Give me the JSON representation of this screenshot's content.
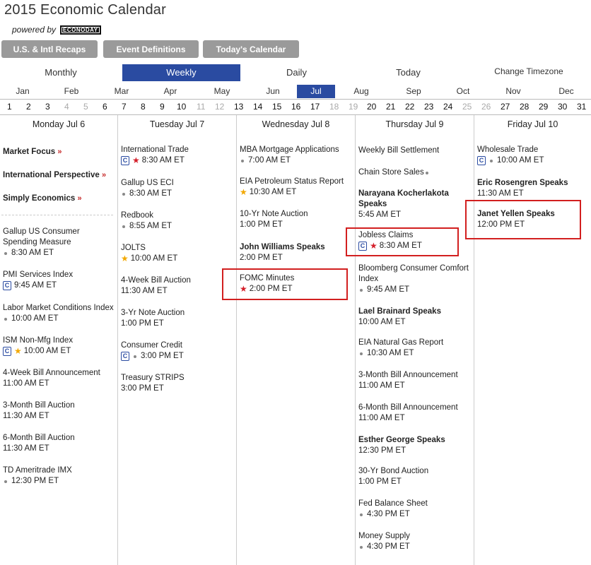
{
  "header": {
    "title": "2015 Economic Calendar",
    "powered_by": "powered by",
    "logo_text": "ECONODAY"
  },
  "top_buttons": [
    "U.S. & Intl Recaps",
    "Event Definitions",
    "Today's Calendar"
  ],
  "views": [
    "Monthly",
    "Weekly",
    "Daily",
    "Today",
    "Change Timezone"
  ],
  "active_view": "Weekly",
  "months": [
    "Jan",
    "Feb",
    "Mar",
    "Apr",
    "May",
    "Jun",
    "Jul",
    "Aug",
    "Sep",
    "Oct",
    "Nov",
    "Dec"
  ],
  "active_month": "Jul",
  "days": [
    "1",
    "2",
    "3",
    "4",
    "5",
    "6",
    "7",
    "8",
    "9",
    "10",
    "11",
    "12",
    "13",
    "14",
    "15",
    "16",
    "17",
    "18",
    "19",
    "20",
    "21",
    "22",
    "23",
    "24",
    "25",
    "26",
    "27",
    "28",
    "29",
    "30",
    "31"
  ],
  "gray_days": [
    "4",
    "5",
    "11",
    "12",
    "18",
    "19",
    "25",
    "26"
  ],
  "colors": {
    "accent": "#2a4ba1",
    "button_gray": "#9a9a9a",
    "star_red": "#d41f2a",
    "star_gold": "#f2a800",
    "highlight": "#d21f1f"
  },
  "icons": {
    "consensus": "C",
    "star": "★",
    "dot": "•",
    "arrow": "»"
  },
  "columns": [
    {
      "header": "Monday Jul 6",
      "features": [
        "Market Focus",
        "International Perspective",
        "Simply Economics"
      ],
      "events": [
        {
          "name": "Gallup US Consumer Spending Measure",
          "time": "8:30 AM ET",
          "dot": true
        },
        {
          "name": "PMI Services Index",
          "time": "9:45 AM ET",
          "c": true
        },
        {
          "name": "Labor Market Conditions Index",
          "time": "10:00 AM ET",
          "dot": true
        },
        {
          "name": "ISM Non-Mfg Index",
          "time": "10:00 AM ET",
          "c": true,
          "star": "gold"
        },
        {
          "name": "4-Week Bill Announcement",
          "time": "11:00 AM ET"
        },
        {
          "name": "3-Month Bill Auction",
          "time": "11:30 AM ET"
        },
        {
          "name": "6-Month Bill Auction",
          "time": "11:30 AM ET"
        },
        {
          "name": "TD Ameritrade IMX",
          "time": "12:30 PM ET",
          "dot": true
        }
      ]
    },
    {
      "header": "Tuesday Jul 7",
      "events": [
        {
          "name": "International Trade",
          "time": "8:30 AM ET",
          "c": true,
          "star": "red"
        },
        {
          "name": "Gallup US ECI",
          "time": "8:30 AM ET",
          "dot": true
        },
        {
          "name": "Redbook",
          "time": "8:55 AM ET",
          "dot": true
        },
        {
          "name": "JOLTS",
          "time": "10:00 AM ET",
          "star": "gold"
        },
        {
          "name": "4-Week Bill Auction",
          "time": "11:30 AM ET"
        },
        {
          "name": "3-Yr Note Auction",
          "time": "1:00 PM ET"
        },
        {
          "name": "Consumer Credit",
          "time": "3:00 PM ET",
          "c": true,
          "dot": true
        },
        {
          "name": "Treasury STRIPS",
          "time": "3:00 PM ET"
        }
      ]
    },
    {
      "header": "Wednesday Jul 8",
      "events": [
        {
          "name": "MBA Mortgage Applications",
          "time": "7:00 AM ET",
          "dot": true
        },
        {
          "name": "EIA Petroleum Status Report",
          "time": "10:30 AM ET",
          "star": "gold"
        },
        {
          "name": "10-Yr Note Auction",
          "time": "1:00 PM ET"
        },
        {
          "name": "John Williams Speaks",
          "time": "2:00 PM ET",
          "bold": true
        },
        {
          "name": "FOMC Minutes",
          "time": "2:00 PM ET",
          "star": "red"
        }
      ]
    },
    {
      "header": "Thursday Jul 9",
      "events": [
        {
          "name": "Weekly Bill Settlement"
        },
        {
          "name": "Chain Store Sales",
          "dot_after": true
        },
        {
          "name": "Narayana Kocherlakota Speaks",
          "time": "5:45 AM ET",
          "bold": true
        },
        {
          "name": "Jobless Claims",
          "time": "8:30 AM ET",
          "c": true,
          "star": "red"
        },
        {
          "name": "Bloomberg Consumer Comfort Index",
          "time": "9:45 AM ET",
          "dot": true
        },
        {
          "name": "Lael Brainard Speaks",
          "time": "10:00 AM ET",
          "bold": true
        },
        {
          "name": "EIA Natural Gas Report",
          "time": "10:30 AM ET",
          "dot": true
        },
        {
          "name": "3-Month Bill Announcement",
          "time": "11:00 AM ET"
        },
        {
          "name": "6-Month Bill Announcement",
          "time": "11:00 AM ET"
        },
        {
          "name": "Esther George Speaks",
          "time": "12:30 PM ET",
          "bold": true
        },
        {
          "name": "30-Yr Bond Auction",
          "time": "1:00 PM ET"
        },
        {
          "name": "Fed Balance Sheet",
          "time": "4:30 PM ET",
          "dot": true
        },
        {
          "name": "Money Supply",
          "time": "4:30 PM ET",
          "dot": true
        }
      ]
    },
    {
      "header": "Friday Jul 10",
      "events": [
        {
          "name": "Wholesale Trade",
          "time": "10:00 AM ET",
          "c": true,
          "dot": true
        },
        {
          "name": "Eric Rosengren Speaks",
          "time": "11:30 AM ET",
          "bold": true
        },
        {
          "name": "Janet Yellen Speaks",
          "time": "12:00 PM ET",
          "bold": true
        }
      ]
    }
  ]
}
